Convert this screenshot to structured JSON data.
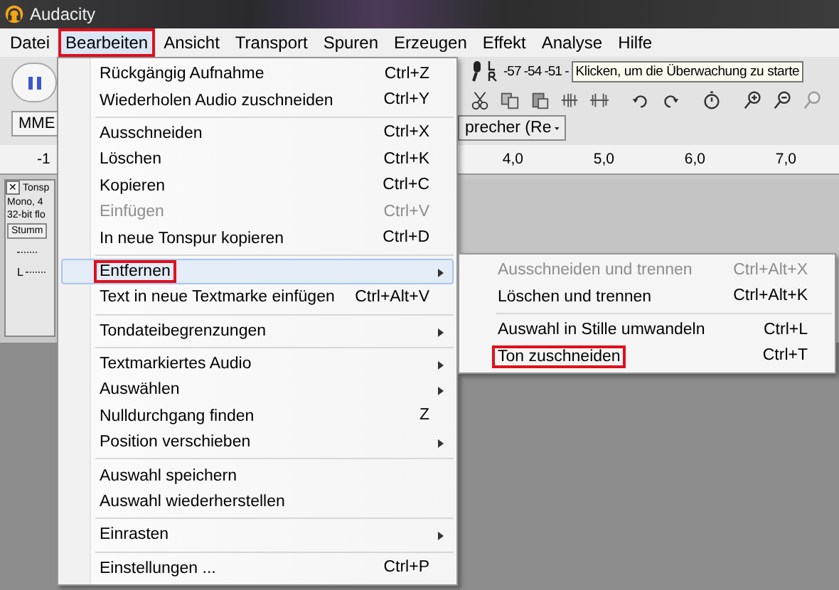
{
  "window": {
    "title": "Audacity"
  },
  "menubar": [
    {
      "label": "Datei",
      "selected": false,
      "highlighted": false
    },
    {
      "label": "Bearbeiten",
      "selected": true,
      "highlighted": true
    },
    {
      "label": "Ansicht",
      "selected": false,
      "highlighted": false
    },
    {
      "label": "Transport",
      "selected": false,
      "highlighted": false
    },
    {
      "label": "Spuren",
      "selected": false,
      "highlighted": false
    },
    {
      "label": "Erzeugen",
      "selected": false,
      "highlighted": false
    },
    {
      "label": "Effekt",
      "selected": false,
      "highlighted": false
    },
    {
      "label": "Analyse",
      "selected": false,
      "highlighted": false
    },
    {
      "label": "Hilfe",
      "selected": false,
      "highlighted": false
    }
  ],
  "toolbar": {
    "meter_scale": "-57 -54 -51 -",
    "tooltip": "Klicken, um die Überwachung zu starte",
    "host": "MME",
    "device": "precher (Re"
  },
  "ruler": {
    "left_label": "-1",
    "ticks": [
      "4,0",
      "5,0",
      "6,0",
      "7,0"
    ]
  },
  "track": {
    "close": "✕",
    "name": "Tonsp",
    "info": [
      "Mono, 4",
      "32-bit flo"
    ],
    "mute": "Stumm",
    "pan": "L"
  },
  "edit_menu": {
    "items": [
      {
        "kind": "item",
        "label": "Rückgängig Aufnahme",
        "shortcut": "Ctrl+Z",
        "disabled": false,
        "submenu": false,
        "selected": false,
        "highlighted": false
      },
      {
        "kind": "item",
        "label": "Wiederholen Audio zuschneiden",
        "shortcut": "Ctrl+Y",
        "disabled": false,
        "submenu": false,
        "selected": false,
        "highlighted": false
      },
      {
        "kind": "separator"
      },
      {
        "kind": "item",
        "label": "Ausschneiden",
        "shortcut": "Ctrl+X",
        "disabled": false,
        "submenu": false,
        "selected": false,
        "highlighted": false
      },
      {
        "kind": "item",
        "label": "Löschen",
        "shortcut": "Ctrl+K",
        "disabled": false,
        "submenu": false,
        "selected": false,
        "highlighted": false
      },
      {
        "kind": "item",
        "label": "Kopieren",
        "shortcut": "Ctrl+C",
        "disabled": false,
        "submenu": false,
        "selected": false,
        "highlighted": false
      },
      {
        "kind": "item",
        "label": "Einfügen",
        "shortcut": "Ctrl+V",
        "disabled": true,
        "submenu": false,
        "selected": false,
        "highlighted": false
      },
      {
        "kind": "item",
        "label": "In neue Tonspur kopieren",
        "shortcut": "Ctrl+D",
        "disabled": false,
        "submenu": false,
        "selected": false,
        "highlighted": false
      },
      {
        "kind": "separator"
      },
      {
        "kind": "item",
        "label": "Entfernen",
        "disabled": false,
        "submenu": true,
        "selected": true,
        "highlighted": true
      },
      {
        "kind": "item",
        "label": "Text in neue Textmarke einfügen",
        "shortcut": "Ctrl+Alt+V",
        "disabled": false,
        "submenu": false,
        "selected": false,
        "highlighted": false
      },
      {
        "kind": "separator"
      },
      {
        "kind": "item",
        "label": "Tondateibegrenzungen",
        "disabled": false,
        "submenu": true,
        "selected": false,
        "highlighted": false
      },
      {
        "kind": "separator"
      },
      {
        "kind": "item",
        "label": "Textmarkiertes Audio",
        "disabled": false,
        "submenu": true,
        "selected": false,
        "highlighted": false
      },
      {
        "kind": "item",
        "label": "Auswählen",
        "disabled": false,
        "submenu": true,
        "selected": false,
        "highlighted": false
      },
      {
        "kind": "item",
        "label": "Nulldurchgang finden",
        "shortcut": "Z",
        "disabled": false,
        "submenu": false,
        "selected": false,
        "highlighted": false
      },
      {
        "kind": "item",
        "label": "Position verschieben",
        "disabled": false,
        "submenu": true,
        "selected": false,
        "highlighted": false
      },
      {
        "kind": "separator"
      },
      {
        "kind": "item",
        "label": "Auswahl speichern",
        "disabled": false,
        "submenu": false,
        "selected": false,
        "highlighted": false
      },
      {
        "kind": "item",
        "label": "Auswahl wiederherstellen",
        "disabled": false,
        "submenu": false,
        "selected": false,
        "highlighted": false
      },
      {
        "kind": "separator"
      },
      {
        "kind": "item",
        "label": "Einrasten",
        "disabled": false,
        "submenu": true,
        "selected": false,
        "highlighted": false
      },
      {
        "kind": "separator"
      },
      {
        "kind": "item",
        "label": "Einstellungen ...",
        "shortcut": "Ctrl+P",
        "disabled": false,
        "submenu": false,
        "selected": false,
        "highlighted": false
      }
    ]
  },
  "remove_submenu": {
    "items": [
      {
        "kind": "item",
        "label": "Ausschneiden und trennen",
        "shortcut": "Ctrl+Alt+X",
        "disabled": true,
        "submenu": false,
        "selected": false,
        "highlighted": false
      },
      {
        "kind": "item",
        "label": "Löschen und trennen",
        "shortcut": "Ctrl+Alt+K",
        "disabled": false,
        "submenu": false,
        "selected": false,
        "highlighted": false
      },
      {
        "kind": "separator"
      },
      {
        "kind": "item",
        "label": "Auswahl in Stille umwandeln",
        "shortcut": "Ctrl+L",
        "disabled": false,
        "submenu": false,
        "selected": false,
        "highlighted": false
      },
      {
        "kind": "item",
        "label": "Ton zuschneiden",
        "shortcut": "Ctrl+T",
        "disabled": false,
        "submenu": false,
        "selected": false,
        "highlighted": true
      }
    ]
  }
}
